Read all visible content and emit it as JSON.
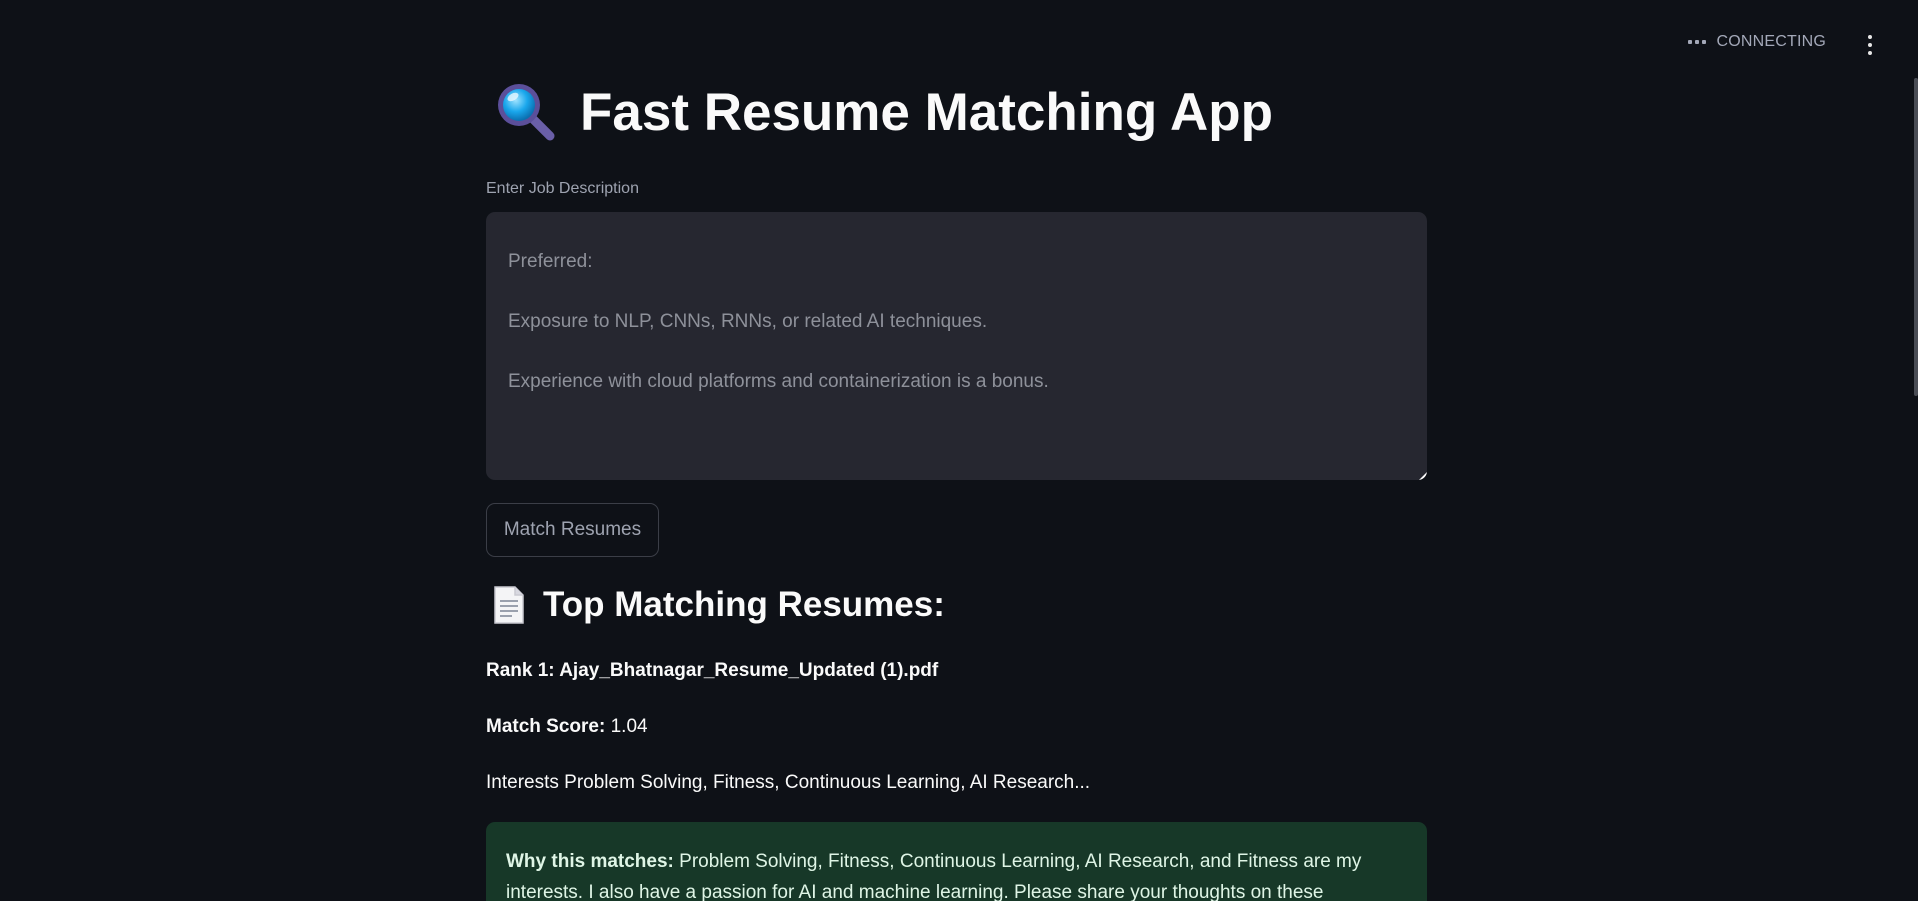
{
  "header": {
    "status_text": "CONNECTING",
    "status_icon": "ellipsis-icon",
    "menu_icon": "vertical-dots-icon"
  },
  "main": {
    "title": "Fast Resume Matching App",
    "title_icon": "magnifying-glass-icon",
    "job_description": {
      "label": "Enter Job Description",
      "lines": [
        "Preferred:",
        "Exposure to NLP, CNNs, RNNs, or related AI techniques.",
        "Experience with cloud platforms and containerization is a bonus."
      ]
    },
    "match_button_label": "Match Resumes",
    "results": {
      "heading": "Top Matching Resumes:",
      "heading_icon": "document-icon",
      "rank_label": "Rank 1: Ajay_Bhatnagar_Resume_Updated (1).pdf",
      "score_label": "Match Score:",
      "score_value": "1.04",
      "snippet": "Interests Problem Solving, Fitness, Continuous Learning, AI Research...",
      "why_label": "Why this matches:",
      "why_text": "Problem Solving, Fitness, Continuous Learning, AI Research, and Fitness are my interests. I also have a passion for AI and machine learning. Please share your thoughts on these"
    }
  },
  "colors": {
    "background": "#0e1117",
    "input_background": "#262730",
    "success_background": "#173828",
    "text": "#fafafa",
    "muted_text": "#9ea3b0"
  }
}
